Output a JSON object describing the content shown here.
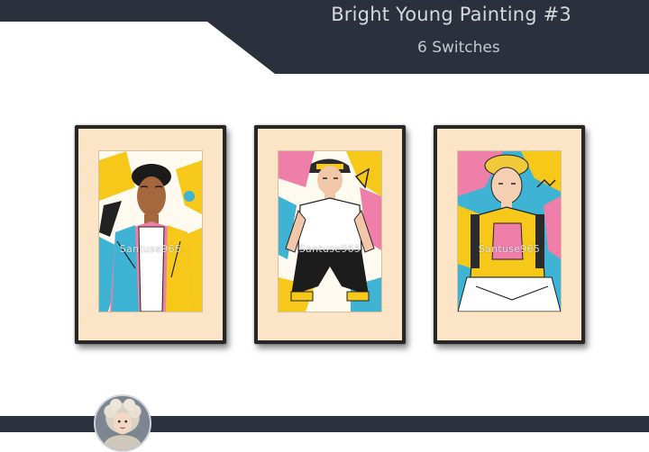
{
  "banner": {
    "title": "Bright Young Painting #3",
    "subtitle": "6 Switches",
    "color": "#2b313c"
  },
  "frames": [
    {
      "watermark": "Santuse965",
      "subject": "young-man-dreadlocks-jacket"
    },
    {
      "watermark": "Santuse965",
      "subject": "young-man-cap-crouching"
    },
    {
      "watermark": "Santuse965",
      "subject": "young-boy-curly-hair-backpack"
    }
  ],
  "colors": {
    "mat": "#fbe5c6",
    "frame": "#262626",
    "footer": "#2c323e",
    "accent_yellow": "#f5c81a",
    "accent_pink": "#ef7fa8",
    "accent_blue": "#3fb3d4"
  }
}
